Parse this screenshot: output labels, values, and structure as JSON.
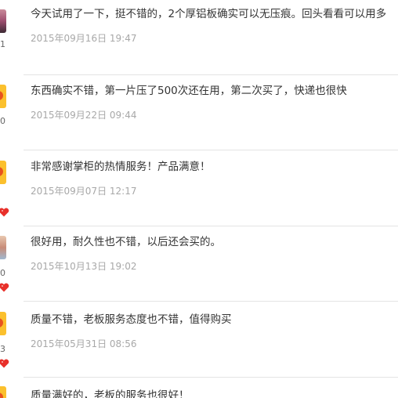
{
  "reviews": [
    {
      "text": "今天试用了一下，挺不错的，2个厚铝板确实可以无压痕。回头看看可以用多",
      "date": "2015年09月16日 19:47",
      "level": "1",
      "avatar": "photo-avatar"
    },
    {
      "text": "东西确实不错，第一片压了500次还在用，第二次买了，快递也很快",
      "date": "2015年09月22日 09:44",
      "level": "0",
      "avatar": "default-avatar"
    },
    {
      "text": "非常感谢掌柜的热情服务！产品满意！",
      "date": "2015年09月07日 12:17",
      "avatar": "default-avatar"
    },
    {
      "text": "很好用，耐久性也不错，以后还会买的。",
      "date": "2015年10月13日 19:02",
      "level": "0",
      "avatar": "photo-avatar"
    },
    {
      "text": "质量不错，老板服务态度也不错，值得购买",
      "date": "2015年05月31日 08:56",
      "level": "3",
      "avatar": "default-avatar"
    },
    {
      "text": "质量满好的，老板的服务也很好！",
      "avatar": "default-avatar"
    }
  ],
  "colors": {
    "text": "#333333",
    "date": "#a8a8a8",
    "divider": "#e4e4e4",
    "heart": "#e8302a"
  }
}
